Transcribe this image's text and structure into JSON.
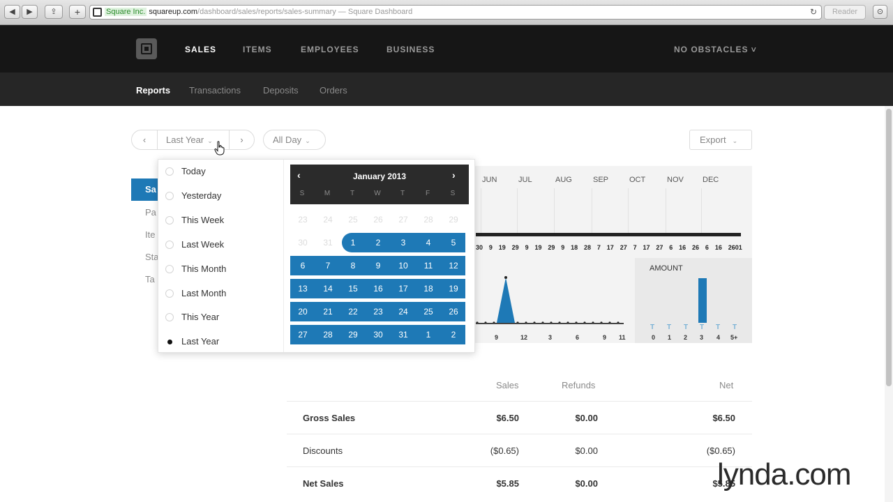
{
  "browser": {
    "nav_back": "◀",
    "nav_forward": "▶",
    "share": "⇪",
    "new_tab": "+",
    "site_identity": "Square Inc.",
    "url_host": "squareup.com",
    "url_path": "/dashboard/sales/reports/sales-summary — Square Dashboard",
    "reload": "↻",
    "reader_label": "Reader",
    "download": "⊙"
  },
  "topnav": {
    "items": [
      "SALES",
      "ITEMS",
      "EMPLOYEES",
      "BUSINESS"
    ],
    "account": "NO OBSTACLES ˅"
  },
  "subnav": {
    "items": [
      "Reports",
      "Transactions",
      "Deposits",
      "Orders"
    ]
  },
  "filters": {
    "prev": "‹",
    "range_label": "Last Year",
    "next": "›",
    "time_label": "All Day",
    "export_label": "Export"
  },
  "side_menu": {
    "active": "Sa",
    "items": [
      "Pa",
      "Ite",
      "Sta",
      "Ta"
    ]
  },
  "presets": [
    "Today",
    "Yesterday",
    "This Week",
    "Last Week",
    "This Month",
    "Last Month",
    "This Year",
    "Last Year"
  ],
  "selected_preset": "Last Year",
  "calendar": {
    "title": "January 2013",
    "prev": "‹",
    "next": "›",
    "weekdays": [
      "S",
      "M",
      "T",
      "W",
      "T",
      "F",
      "S"
    ],
    "weeks": [
      [
        "23",
        "24",
        "25",
        "26",
        "27",
        "28",
        "29"
      ],
      [
        "30",
        "31",
        "1",
        "2",
        "3",
        "4",
        "5"
      ],
      [
        "6",
        "7",
        "8",
        "9",
        "10",
        "11",
        "12"
      ],
      [
        "13",
        "14",
        "15",
        "16",
        "17",
        "18",
        "19"
      ],
      [
        "20",
        "21",
        "22",
        "23",
        "24",
        "25",
        "26"
      ],
      [
        "27",
        "28",
        "29",
        "30",
        "31",
        "1",
        "2"
      ]
    ]
  },
  "chart": {
    "months": [
      "JUN",
      "JUL",
      "AUG",
      "SEP",
      "OCT",
      "NOV",
      "DEC"
    ],
    "timeline_ticks": [
      "30",
      "9",
      "19",
      "29",
      "9",
      "19",
      "29",
      "9",
      "18",
      "28",
      "7",
      "17",
      "27",
      "7",
      "17",
      "27",
      "6",
      "16",
      "26",
      "6",
      "16",
      "2601"
    ],
    "hour_labels": [
      "9",
      "12",
      "3",
      "6",
      "9",
      "11"
    ],
    "amount_title": "AMOUNT",
    "amount_labels": [
      "0",
      "1",
      "2",
      "3",
      "4",
      "5+"
    ],
    "amount_tick_glyph": "T"
  },
  "summary": {
    "headers": [
      "Sales",
      "Refunds",
      "Net"
    ],
    "rows": [
      {
        "label": "Gross Sales",
        "sales": "$6.50",
        "refunds": "$0.00",
        "net": "$6.50"
      },
      {
        "label": "Discounts",
        "sales": "($0.65)",
        "refunds": "$0.00",
        "net": "($0.65)"
      },
      {
        "label": "Net Sales",
        "sales": "$5.85",
        "refunds": "$0.00",
        "net": "$5.85"
      }
    ]
  },
  "watermark": "lynda.com",
  "colors": {
    "accent": "#1e79b6",
    "nav_bg": "#161616",
    "subnav_bg": "#262626"
  }
}
